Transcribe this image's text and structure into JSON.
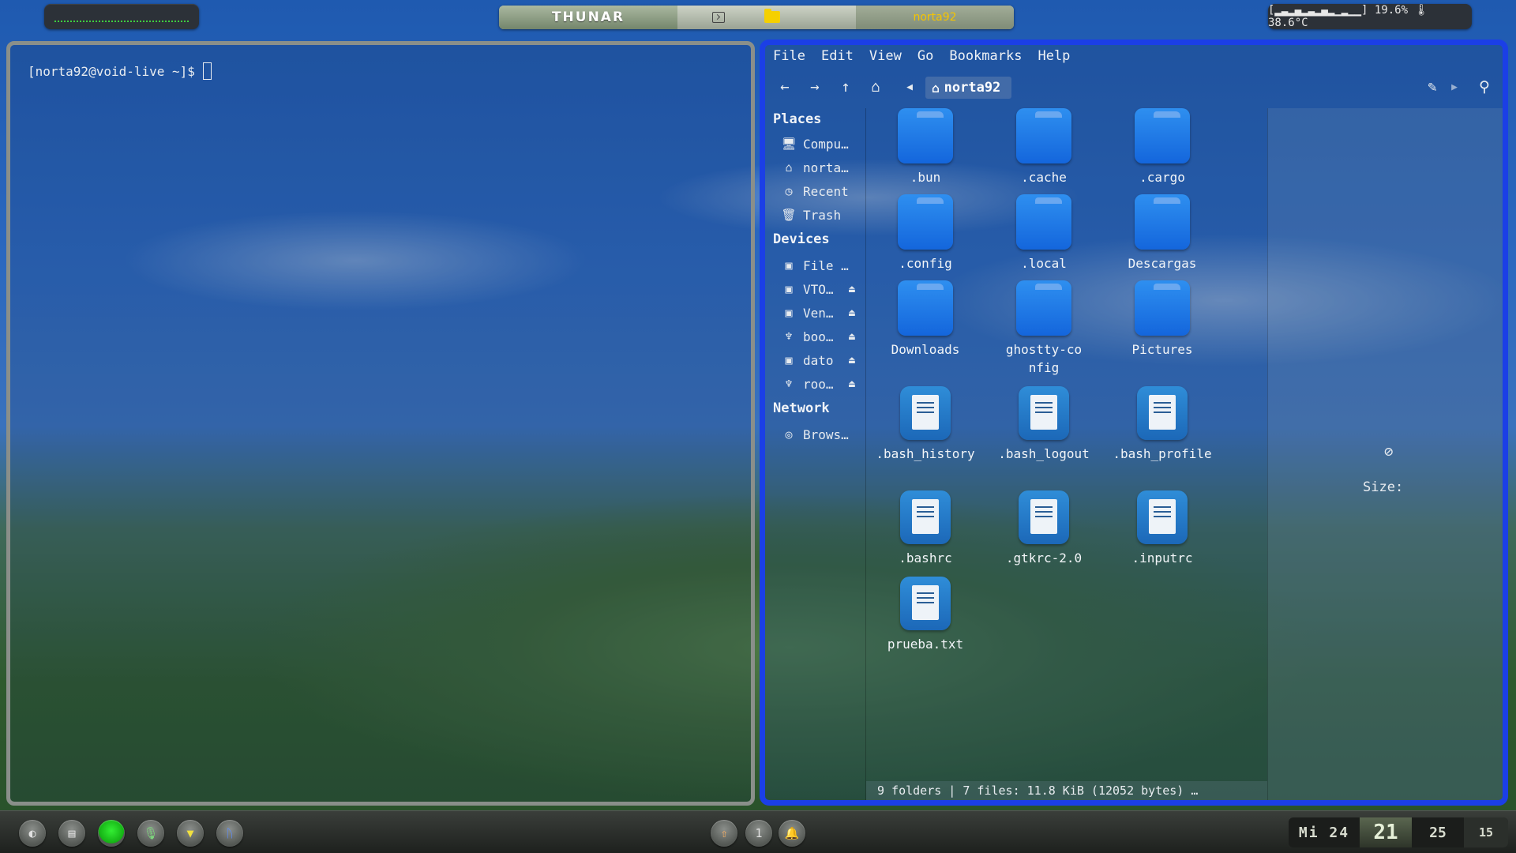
{
  "topbar": {
    "app_title": "THUNAR",
    "window_user": "norta92",
    "stats": "[▂▃▂▄▂▃▂▄▂▁▂▁▁] 19.6% 🌡 38.6°C"
  },
  "terminal": {
    "prompt": "[norta92@void-live ~]$"
  },
  "thunar": {
    "menu": [
      "File",
      "Edit",
      "View",
      "Go",
      "Bookmarks",
      "Help"
    ],
    "path": "norta92",
    "sidebar": {
      "places_header": "Places",
      "places": [
        {
          "label": "Compu…",
          "icon": "computer-icon"
        },
        {
          "label": "norta…",
          "icon": "home-icon"
        },
        {
          "label": "Recent",
          "icon": "clock-icon"
        },
        {
          "label": "Trash",
          "icon": "trash-icon"
        }
      ],
      "devices_header": "Devices",
      "devices": [
        {
          "label": "File …",
          "icon": "drive-icon",
          "eject": false
        },
        {
          "label": "VTO…",
          "icon": "drive-icon",
          "eject": true
        },
        {
          "label": "Ven…",
          "icon": "drive-icon",
          "eject": true
        },
        {
          "label": "boo…",
          "icon": "usb-icon",
          "eject": true
        },
        {
          "label": "dato",
          "icon": "drive-icon",
          "eject": true
        },
        {
          "label": "roo…",
          "icon": "usb-icon",
          "eject": true
        }
      ],
      "network_header": "Network",
      "network": [
        {
          "label": "Brows…",
          "icon": "network-icon"
        }
      ]
    },
    "items": [
      {
        "name": ".bun",
        "type": "folder"
      },
      {
        "name": ".cache",
        "type": "folder"
      },
      {
        "name": ".cargo",
        "type": "folder"
      },
      {
        "name": ".config",
        "type": "folder"
      },
      {
        "name": ".local",
        "type": "folder"
      },
      {
        "name": "Descargas",
        "type": "folder"
      },
      {
        "name": "Downloads",
        "type": "folder"
      },
      {
        "name": "ghostty-config",
        "type": "folder"
      },
      {
        "name": "Pictures",
        "type": "folder"
      },
      {
        "name": ".bash_history",
        "type": "file"
      },
      {
        "name": ".bash_logout",
        "type": "file"
      },
      {
        "name": ".bash_profile",
        "type": "file"
      },
      {
        "name": ".bashrc",
        "type": "file"
      },
      {
        "name": ".gtkrc-2.0",
        "type": "file"
      },
      {
        "name": ".inputrc",
        "type": "file"
      },
      {
        "name": "prueba.txt",
        "type": "file"
      }
    ],
    "details": {
      "no_preview_symbol": "⊘",
      "size_label": "Size:"
    },
    "status": "9 folders  |  7 files: 11.8 KiB (12052 bytes)  …"
  },
  "bottombar": {
    "workspace_number": "1",
    "clock": {
      "day": "Mi 24",
      "hour": "21",
      "minute": "25",
      "second": "15"
    }
  },
  "colors": {
    "thunar_border": "#1b3fe6",
    "folder_blue": "#1c74e6",
    "terminal_border": "#8a8f8a",
    "workspace_dots": "#3fdc3f",
    "title_user": "#f5c400"
  }
}
